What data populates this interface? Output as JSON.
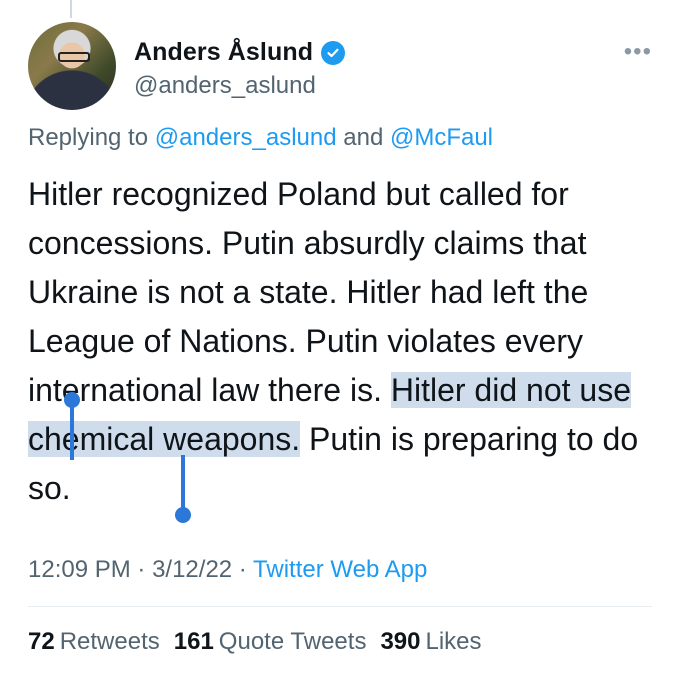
{
  "author": {
    "display_name": "Anders Åslund",
    "handle": "@anders_aslund",
    "verified": true
  },
  "reply": {
    "prefix": "Replying to ",
    "to_1": "@anders_aslund",
    "joiner": " and ",
    "to_2": "@McFaul"
  },
  "tweet": {
    "text_before": "Hitler recognized Poland but called for concessions. Putin absurdly claims that Ukraine is not a state. Hitler had left the League of Nations. Putin violates every international law there is. ",
    "text_selected": "Hitler did not use chemical weapons.",
    "text_after": " Putin is preparing to do so."
  },
  "meta": {
    "time": "12:09 PM",
    "sep1": " · ",
    "date": "3/12/22",
    "sep2": " · ",
    "source": "Twitter Web App"
  },
  "stats": {
    "retweets_count": "72",
    "retweets_label": "Retweets",
    "quotes_count": "161",
    "quotes_label": "Quote Tweets",
    "likes_count": "390",
    "likes_label": "Likes"
  },
  "colors": {
    "accent": "#1d9bf0",
    "selection": "#cfdcec",
    "selection_handle": "#2b78d8"
  },
  "icons": {
    "more": "more-horizontal-icon",
    "verified": "verified-badge-icon"
  }
}
